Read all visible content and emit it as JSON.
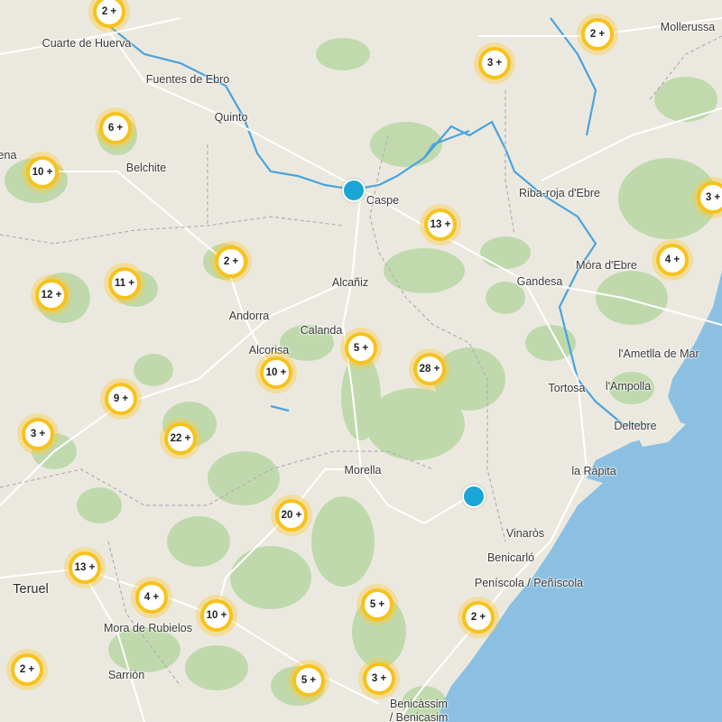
{
  "map": {
    "colors": {
      "land": "#ebe9df",
      "sea": "#8cc0e2",
      "river": "#4aa3de",
      "forest": "#b8d7a5",
      "cluster_ring": "#f7c21b",
      "marker": "#19a6d6"
    },
    "places": [
      {
        "id": "cuarte",
        "name": "Cuarte de Huerva"
      },
      {
        "id": "fuentes",
        "name": "Fuentes de Ebro"
      },
      {
        "id": "quinto",
        "name": "Quinto"
      },
      {
        "id": "belchite",
        "name": "Belchite"
      },
      {
        "id": "ena",
        "name": "ena"
      },
      {
        "id": "mollerussa",
        "name": "Mollerussa"
      },
      {
        "id": "caspe",
        "name": "Caspe"
      },
      {
        "id": "ribaroja",
        "name": "Riba-roja d'Ebre"
      },
      {
        "id": "mora",
        "name": "Móra d'Ebre"
      },
      {
        "id": "gandesa",
        "name": "Gandesa"
      },
      {
        "id": "alcaniz",
        "name": "Alcañiz"
      },
      {
        "id": "andorra",
        "name": "Andorra"
      },
      {
        "id": "calanda",
        "name": "Calanda"
      },
      {
        "id": "alcorisa",
        "name": "Alcorisa"
      },
      {
        "id": "ametlla",
        "name": "l'Ametlla de Mar"
      },
      {
        "id": "tortosa",
        "name": "Tortosa"
      },
      {
        "id": "ampolla",
        "name": "l'Ampolla"
      },
      {
        "id": "deltebre",
        "name": "Deltebre"
      },
      {
        "id": "rapita",
        "name": "la Ràpita"
      },
      {
        "id": "morella",
        "name": "Morella"
      },
      {
        "id": "vinaros",
        "name": "Vinaròs"
      },
      {
        "id": "benicarlo",
        "name": "Benicarló"
      },
      {
        "id": "peniscola",
        "name": "Peníscola / Peñíscola"
      },
      {
        "id": "teruel",
        "name": "Teruel"
      },
      {
        "id": "mora_rubielos",
        "name": "Mora de Rubielos"
      },
      {
        "id": "sarrion",
        "name": "Sarrión"
      },
      {
        "id": "benicassim",
        "name": "Benicàssim"
      },
      {
        "id": "benicasim",
        "name": "/ Benicasim"
      }
    ],
    "clusters": [
      {
        "label": "2 +"
      },
      {
        "label": "2 +"
      },
      {
        "label": "3 +"
      },
      {
        "label": "6 +"
      },
      {
        "label": "10 +"
      },
      {
        "label": "3 +"
      },
      {
        "label": "13 +"
      },
      {
        "label": "2 +"
      },
      {
        "label": "11 +"
      },
      {
        "label": "12 +"
      },
      {
        "label": "4 +"
      },
      {
        "label": "5 +"
      },
      {
        "label": "10 +"
      },
      {
        "label": "28 +"
      },
      {
        "label": "9 +"
      },
      {
        "label": "3 +"
      },
      {
        "label": "22 +"
      },
      {
        "label": "20 +"
      },
      {
        "label": "13 +"
      },
      {
        "label": "4 +"
      },
      {
        "label": "10 +"
      },
      {
        "label": "5 +"
      },
      {
        "label": "2 +"
      },
      {
        "label": "2 +"
      },
      {
        "label": "5 +"
      },
      {
        "label": "3 +"
      }
    ],
    "markers": [
      {
        "id": "marker-caspe"
      },
      {
        "id": "marker-traiguera"
      }
    ]
  }
}
